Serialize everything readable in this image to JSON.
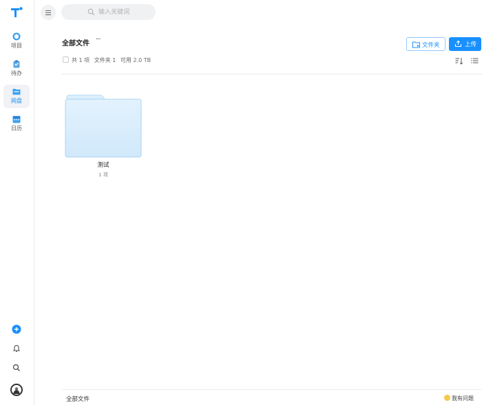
{
  "sidebar": {
    "items": [
      {
        "label": "项目",
        "icon": "cube-icon"
      },
      {
        "label": "待办",
        "icon": "clipboard-icon"
      },
      {
        "label": "网盘",
        "icon": "drive-icon"
      },
      {
        "label": "日历",
        "icon": "calendar-icon"
      }
    ],
    "active_index": 2
  },
  "search": {
    "placeholder": "输入关键词"
  },
  "header": {
    "title": "全部文件",
    "more": "···",
    "new_folder_label": "文件夹",
    "upload_label": "上传"
  },
  "stats": {
    "total": "共 1 项",
    "folders": "文件夹 1",
    "available": "可用 2.0 TB"
  },
  "files": [
    {
      "name": "测试",
      "count": "1 项",
      "type": "folder"
    }
  ],
  "footer": {
    "breadcrumb": "全部文件",
    "help": "我有问题"
  },
  "colors": {
    "accent": "#1890ff",
    "folder_fill": "#d6ecfb",
    "folder_border": "#a9d4f2"
  }
}
